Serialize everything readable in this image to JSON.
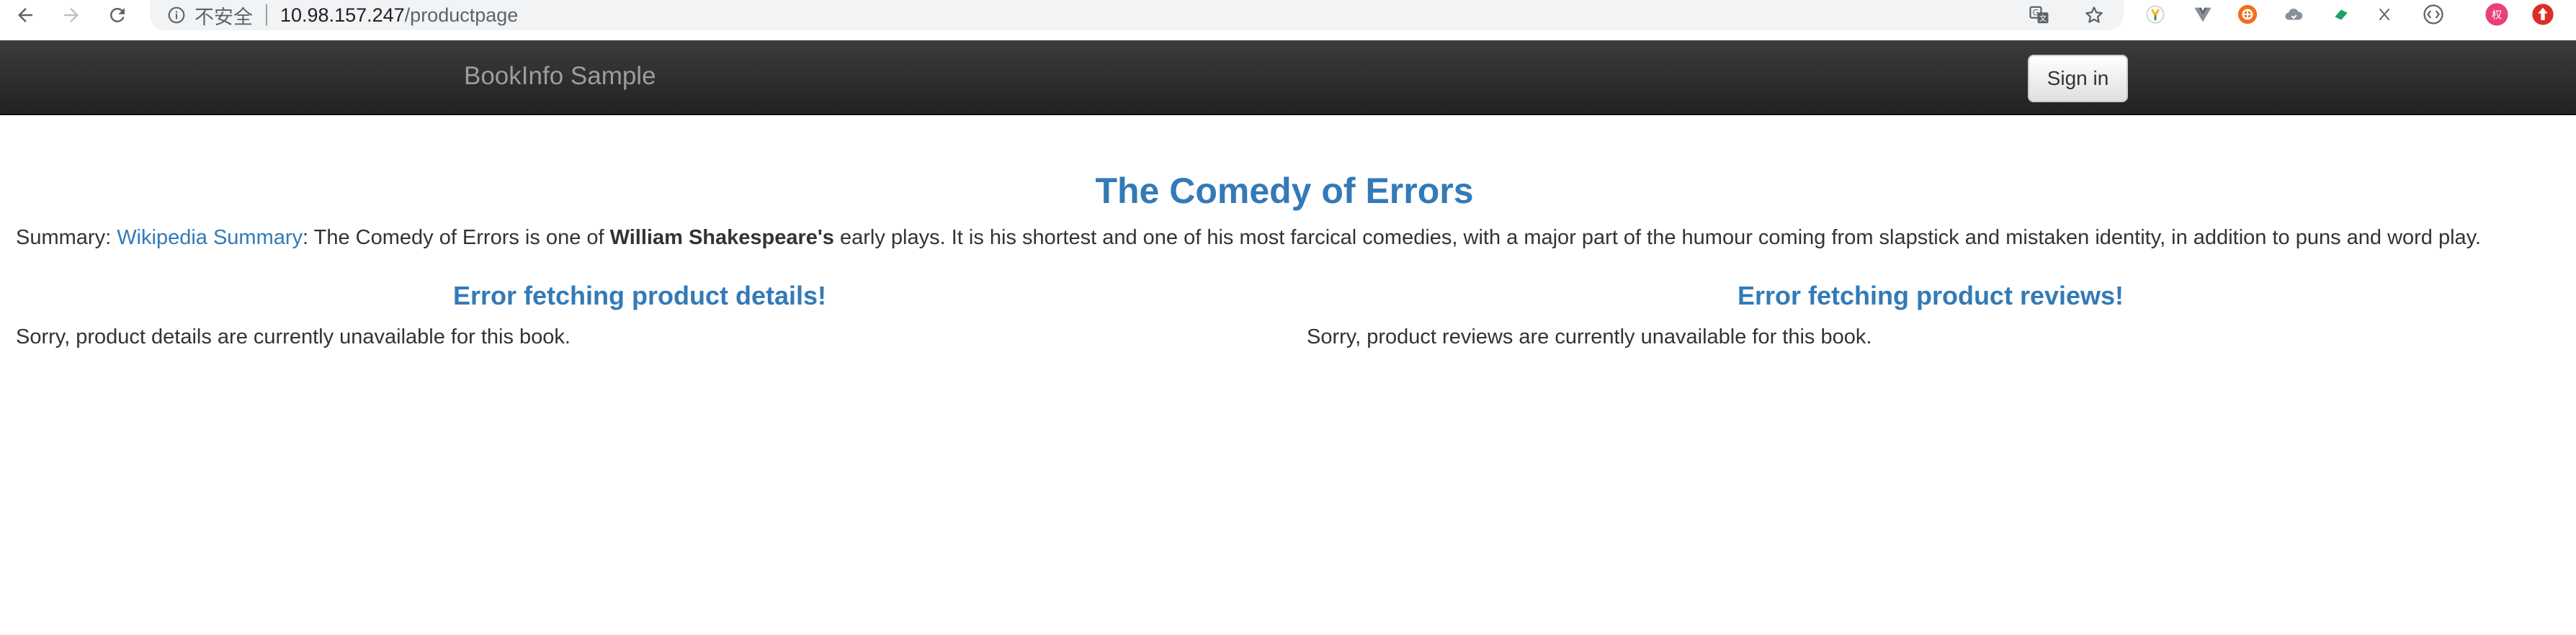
{
  "browser": {
    "security_label": "不安全",
    "url_host": "10.98.157.247",
    "url_path": "/productpage",
    "extensions": [
      {
        "name": "yandex-ext-icon",
        "color": "#f2b01e"
      },
      {
        "name": "vue-devtools-icon",
        "color": "#8a9099"
      },
      {
        "name": "orange-ext-icon",
        "color": "#f0701e"
      },
      {
        "name": "cloud-ext-icon",
        "color": "#8a9099"
      },
      {
        "name": "green-flag-ext-icon",
        "color": "#1aa260"
      },
      {
        "name": "x-ext-icon",
        "color": "#5f6368"
      },
      {
        "name": "code-ext-icon",
        "color": "#5f6368"
      },
      {
        "name": "profile-avatar",
        "color": "#e8417a",
        "text": "权"
      },
      {
        "name": "update-icon",
        "color": "#d93025"
      }
    ]
  },
  "navbar": {
    "brand": "BookInfo Sample",
    "signin_label": "Sign in"
  },
  "product": {
    "title": "The Comedy of Errors",
    "summary_prefix": "Summary: ",
    "summary_link": "Wikipedia Summary",
    "summary_mid": ": The Comedy of Errors is one of ",
    "summary_bold": "William Shakespeare's",
    "summary_rest": " early plays. It is his shortest and one of his most farcical comedies, with a major part of the humour coming from slapstick and mistaken identity, in addition to puns and word play."
  },
  "details": {
    "heading": "Error fetching product details!",
    "message": "Sorry, product details are currently unavailable for this book."
  },
  "reviews": {
    "heading": "Error fetching product reviews!",
    "message": "Sorry, product reviews are currently unavailable for this book."
  },
  "colors": {
    "link": "#337ab7",
    "navbar_top": "#3c3c3c",
    "navbar_bottom": "#222222",
    "brand_text": "#9d9d9d"
  }
}
